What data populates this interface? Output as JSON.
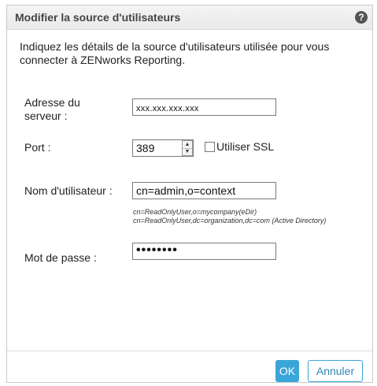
{
  "dialog": {
    "title": "Modifier la source d'utilisateurs",
    "help_icon": "?",
    "intro": "Indiquez les détails de la source d'utilisateurs utilisée pour vous connecter à ZENworks Reporting."
  },
  "form": {
    "server_label_line1": "Adresse du",
    "server_label_line2": "serveur :",
    "server_value": "xxx.xxx.xxx.xxx",
    "port_label": "Port :",
    "port_value": "389",
    "ssl_label": "Utiliser SSL",
    "ssl_checked": false,
    "username_label": "Nom d'utilisateur :",
    "username_value": "cn=admin,o=context",
    "hint_line1": "cn=ReadOnlyUser,o=mycompany(eDir)",
    "hint_line2": "cn=ReadOnlyUser,dc=organization,dc=com (Active Directory)",
    "password_label": "Mot de passe :",
    "password_value": "••••••••"
  },
  "buttons": {
    "ok": "OK",
    "cancel": "Annuler"
  },
  "colors": {
    "accent": "#3aa6d8",
    "title_bar": "#ececec"
  },
  "icons": {
    "help": "help-icon",
    "spinner_up": "arrow-up-icon",
    "spinner_down": "arrow-down-icon"
  }
}
